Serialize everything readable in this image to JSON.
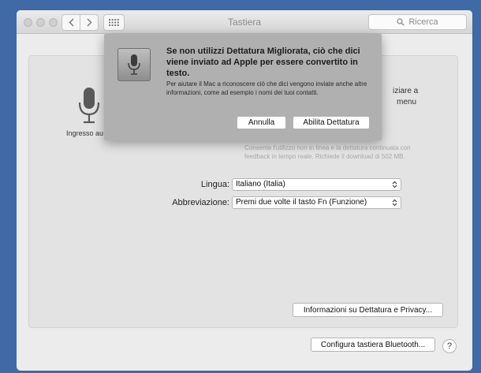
{
  "window": {
    "title": "Tastiera"
  },
  "toolbar": {
    "search_placeholder": "Ricerca"
  },
  "panel": {
    "mic_label": "Ingresso au",
    "partial_line1": "iziare a",
    "partial_line2": "menu",
    "description": "Consente l'utilizzo non in linea e la dettatura continuata con feedback in tempo reale. Richiede il download di 502 MB.",
    "language_label": "Lingua:",
    "language_value": "Italiano (Italia)",
    "shortcut_label": "Abbreviazione:",
    "shortcut_value": "Premi due volte il tasto Fn (Funzione)",
    "info_button": "Informazioni su Dettatura e Privacy...",
    "bluetooth_button": "Configura tastiera Bluetooth...",
    "help_button": "?"
  },
  "dialog": {
    "title": "Se non utilizzi Dettatura Migliorata, ciò che dici viene inviato ad Apple per essere convertito in testo.",
    "body": "Per aiutare il Mac a riconoscere ciò che dici vengono inviate anche altre informazioni, come ad esempio i nomi dei tuoi contatti.",
    "cancel_button": "Annulla",
    "enable_button": "Abilita Dettatura"
  }
}
